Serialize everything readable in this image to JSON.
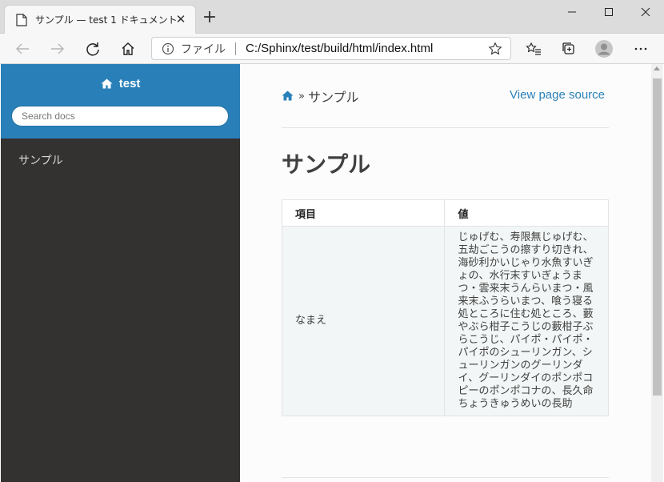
{
  "browser": {
    "tab_title": "サンプル — test 1 ドキュメント",
    "tab_close": "✕",
    "new_tab": "+",
    "address_label": "ファイル",
    "address_url": "C:/Sphinx/test/build/html/index.html"
  },
  "sidebar": {
    "project_name": "test",
    "search_placeholder": "Search docs",
    "nav_items": [
      {
        "label": "サンプル"
      }
    ]
  },
  "content": {
    "breadcrumb_sep": "»",
    "breadcrumb_current": "サンプル",
    "view_source": "View page source",
    "heading": "サンプル",
    "table": {
      "headers": [
        "項目",
        "値"
      ],
      "rows": [
        [
          "なまえ",
          "じゅげむ、寿限無じゅげむ、五劫ごこうの擦すり切きれ、海砂利かいじゃり水魚すいぎょの、水行末すいぎょうまつ・雲来末うんらいまつ・風来末ふうらいまつ、喰う寝る処ところに住む処ところ、藪やぶら柑子こうじの藪柑子ぶらこうじ、パイポ・パイポ・パイポのシューリンガン、シューリンガンのグーリンダイ、グーリンダイのポンポコピーのポンポコナの、長久命ちょうきゅうめいの長助"
        ]
      ]
    }
  },
  "colors": {
    "sidebar_bg": "#343131",
    "brand_blue": "#2980b9",
    "content_bg": "#fcfcfc"
  },
  "icons": [
    "page-icon",
    "close-icon",
    "plus-icon",
    "minimize-icon",
    "maximize-icon",
    "window-close-icon",
    "back-arrow-icon",
    "forward-arrow-icon",
    "refresh-icon",
    "home-icon",
    "info-icon",
    "star-icon",
    "favorites-icon",
    "collections-icon",
    "profile-icon",
    "more-icon"
  ]
}
